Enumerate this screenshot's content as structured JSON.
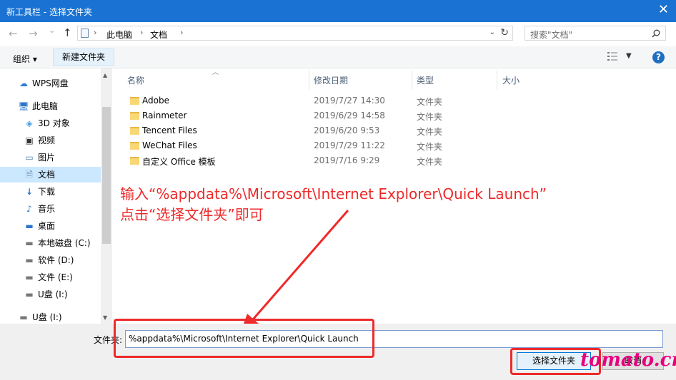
{
  "window": {
    "title": "新工具栏 - 选择文件夹"
  },
  "nav": {
    "back": "←",
    "forward": "→",
    "recent": "⌄",
    "up": "↑"
  },
  "address": {
    "crumbs": [
      "此电脑",
      "文档"
    ],
    "sep": "›",
    "dropdown": "⌄",
    "refresh": "↻"
  },
  "search": {
    "placeholder": "搜索\"文档\""
  },
  "toolbar": {
    "organize": "组织 ▾",
    "new_folder": "新建文件夹",
    "help": "?"
  },
  "sidebar": {
    "items": [
      {
        "label": "WPS网盘",
        "icon": "cloud-icon"
      },
      {
        "label": "此电脑",
        "icon": "computer-icon"
      },
      {
        "label": "3D 对象",
        "icon": "cube-icon"
      },
      {
        "label": "视频",
        "icon": "video-icon"
      },
      {
        "label": "图片",
        "icon": "picture-icon"
      },
      {
        "label": "文档",
        "icon": "document-icon",
        "selected": true
      },
      {
        "label": "下载",
        "icon": "download-icon"
      },
      {
        "label": "音乐",
        "icon": "music-icon"
      },
      {
        "label": "桌面",
        "icon": "desktop-icon"
      },
      {
        "label": "本地磁盘 (C:)",
        "icon": "drive-icon"
      },
      {
        "label": "软件 (D:)",
        "icon": "drive-icon"
      },
      {
        "label": "文件 (E:)",
        "icon": "drive-icon"
      },
      {
        "label": "U盘 (I:)",
        "icon": "drive-icon"
      },
      {
        "label": "U盘 (I:)",
        "icon": "usb-drive-icon"
      }
    ]
  },
  "columns": {
    "name": "名称",
    "date": "修改日期",
    "type": "类型",
    "size": "大小"
  },
  "files": [
    {
      "name": "Adobe",
      "date": "2019/7/27 14:30",
      "type": "文件夹"
    },
    {
      "name": "Rainmeter",
      "date": "2019/6/29 14:58",
      "type": "文件夹"
    },
    {
      "name": "Tencent Files",
      "date": "2019/6/20 9:53",
      "type": "文件夹"
    },
    {
      "name": "WeChat Files",
      "date": "2019/7/29 11:22",
      "type": "文件夹"
    },
    {
      "name": "自定义 Office 模板",
      "date": "2019/7/16 9:29",
      "type": "文件夹"
    }
  ],
  "annotation": {
    "line1": "输入“%appdata%\\Microsoft\\Internet Explorer\\Quick Launch”",
    "line2": "点击“选择文件夹”即可",
    "color": "#ee2a2a"
  },
  "footer": {
    "folder_label": "文件夹:",
    "folder_value": "%appdata%\\Microsoft\\Internet Explorer\\Quick Launch",
    "select_button": "选择文件夹",
    "cancel_button": "取消"
  },
  "watermark": "tomato.cm"
}
